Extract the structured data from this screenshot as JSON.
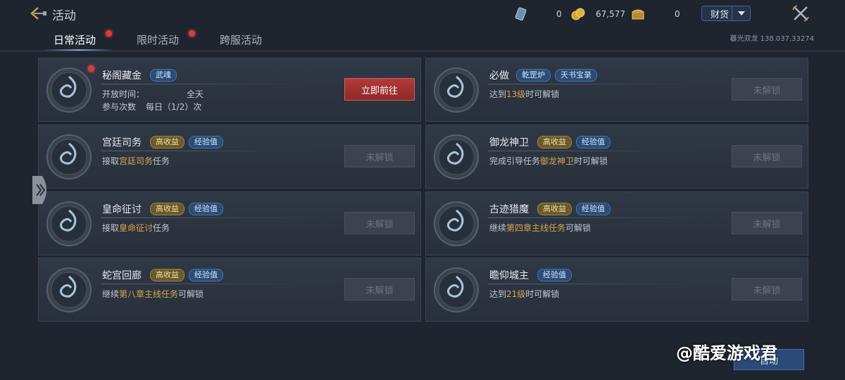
{
  "header": {
    "title": "活动",
    "resources": [
      {
        "icon": "ticket-icon",
        "value": "0"
      },
      {
        "icon": "gold-coins-icon",
        "value": "67,577"
      },
      {
        "icon": "treasure-chest-icon",
        "value": "0"
      }
    ],
    "wealth_label": "财货"
  },
  "tabs": [
    {
      "label": "日常活动",
      "active": true,
      "dot": true
    },
    {
      "label": "限时活动",
      "active": false,
      "dot": true
    },
    {
      "label": "跨服活动",
      "active": false,
      "dot": false
    }
  ],
  "server_info": "暮光双龙  138.037.33274",
  "cards": [
    {
      "name": "秘阁藏金",
      "tags": [
        {
          "text": "武魂",
          "style": "blue"
        }
      ],
      "desc_label1": "开放时间：",
      "desc_value1": "全天",
      "desc_label2": "参与次数",
      "desc_value2": "每日（1/2）次",
      "button": "立即前往",
      "locked": false,
      "dot": true,
      "emblem": "vortex-emblem-icon"
    },
    {
      "name": "必做",
      "tags": [
        {
          "text": "乾罡炉",
          "style": "blue"
        },
        {
          "text": "天书宝录",
          "style": "blue"
        }
      ],
      "desc_pre": "达到",
      "desc_hl": "13级",
      "desc_post": "时可解锁",
      "button": "未解锁",
      "locked": true,
      "dot": false,
      "emblem": "chest-emblem-icon"
    },
    {
      "name": "宫廷司务",
      "tags": [
        {
          "text": "高收益",
          "style": "gold"
        },
        {
          "text": "经验值",
          "style": "blue"
        }
      ],
      "desc_pre": "接取",
      "desc_hl": "宫廷司务",
      "desc_post": "任务",
      "button": "未解锁",
      "locked": true,
      "dot": false,
      "emblem": "palace-emblem-icon"
    },
    {
      "name": "御龙神卫",
      "tags": [
        {
          "text": "高收益",
          "style": "gold"
        },
        {
          "text": "经验值",
          "style": "blue"
        }
      ],
      "desc_pre": "完成引导任务",
      "desc_hl": "御龙神卫",
      "desc_post": "时可解锁",
      "button": "未解锁",
      "locked": true,
      "dot": false,
      "emblem": "dragon-emblem-icon"
    },
    {
      "name": "皇命征讨",
      "tags": [
        {
          "text": "高收益",
          "style": "gold"
        },
        {
          "text": "经验值",
          "style": "blue"
        }
      ],
      "desc_pre": "接取",
      "desc_hl": "皇命征讨",
      "desc_post": "任务",
      "button": "未解锁",
      "locked": true,
      "dot": false,
      "emblem": "warrior-emblem-icon"
    },
    {
      "name": "古迹猎魔",
      "tags": [
        {
          "text": "高收益",
          "style": "gold"
        },
        {
          "text": "经验值",
          "style": "blue"
        }
      ],
      "desc_pre": "继续",
      "desc_hl": "第四章主线任务",
      "desc_post": "可解锁",
      "button": "未解锁",
      "locked": true,
      "dot": false,
      "emblem": "beast-emblem-icon"
    },
    {
      "name": "蛇宫回廊",
      "tags": [
        {
          "text": "高收益",
          "style": "gold"
        },
        {
          "text": "经验值",
          "style": "blue"
        }
      ],
      "desc_pre": "继续",
      "desc_hl": "第八章主线任务",
      "desc_post": "可解锁",
      "button": "未解锁",
      "locked": true,
      "dot": false,
      "emblem": "serpent-emblem-icon"
    },
    {
      "name": "瞻仰城主",
      "tags": [
        {
          "text": "经验值",
          "style": "blue"
        }
      ],
      "desc_pre": "达到",
      "desc_hl": "21级",
      "desc_post": "时可解锁",
      "button": "未解锁",
      "locked": true,
      "dot": false,
      "emblem": "lord-emblem-icon"
    }
  ],
  "watermark": "@酷爱游戏君",
  "bottom_button": "自动"
}
